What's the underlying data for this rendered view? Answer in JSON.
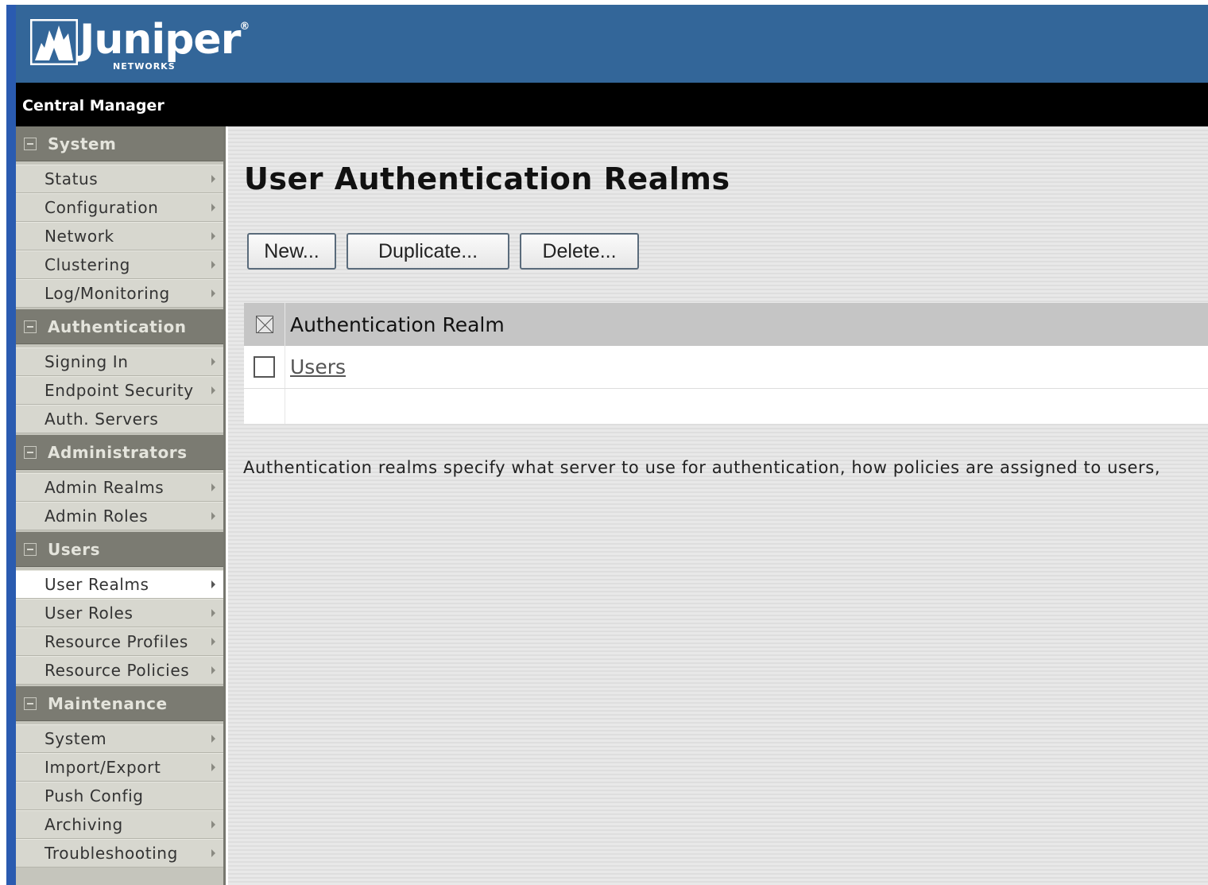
{
  "brand": {
    "logo_word": "Juniper",
    "logo_sub": "NETWORKS",
    "logo_reg": "®"
  },
  "titlebar": {
    "title": "Central Manager"
  },
  "sidebar": {
    "sections": [
      {
        "label": "System",
        "items": [
          {
            "label": "Status",
            "arrow": true
          },
          {
            "label": "Configuration",
            "arrow": true
          },
          {
            "label": "Network",
            "arrow": true
          },
          {
            "label": "Clustering",
            "arrow": true
          },
          {
            "label": "Log/Monitoring",
            "arrow": true
          }
        ]
      },
      {
        "label": "Authentication",
        "items": [
          {
            "label": "Signing In",
            "arrow": true
          },
          {
            "label": "Endpoint Security",
            "arrow": true
          },
          {
            "label": "Auth. Servers",
            "arrow": false
          }
        ]
      },
      {
        "label": "Administrators",
        "items": [
          {
            "label": "Admin Realms",
            "arrow": true
          },
          {
            "label": "Admin Roles",
            "arrow": true
          }
        ]
      },
      {
        "label": "Users",
        "items": [
          {
            "label": "User Realms",
            "arrow": true,
            "active": true
          },
          {
            "label": "User Roles",
            "arrow": true
          },
          {
            "label": "Resource Profiles",
            "arrow": true
          },
          {
            "label": "Resource Policies",
            "arrow": true
          }
        ]
      },
      {
        "label": "Maintenance",
        "items": [
          {
            "label": "System",
            "arrow": true
          },
          {
            "label": "Import/Export",
            "arrow": true
          },
          {
            "label": "Push Config",
            "arrow": false
          },
          {
            "label": "Archiving",
            "arrow": true
          },
          {
            "label": "Troubleshooting",
            "arrow": true
          }
        ]
      }
    ]
  },
  "main": {
    "title": "User Authentication Realms",
    "buttons": {
      "new": "New...",
      "duplicate": "Duplicate...",
      "delete": "Delete..."
    },
    "table": {
      "header": "Authentication Realm",
      "rows": [
        {
          "name": "Users",
          "checked": false
        }
      ]
    },
    "description": "Authentication realms specify what server to use for authentication, how policies are assigned to users,"
  },
  "colors": {
    "header_blue": "#336699",
    "titlebar": "#000000",
    "sidebar_section": "#7b7b72",
    "sidebar_item": "#d7d7cf"
  }
}
